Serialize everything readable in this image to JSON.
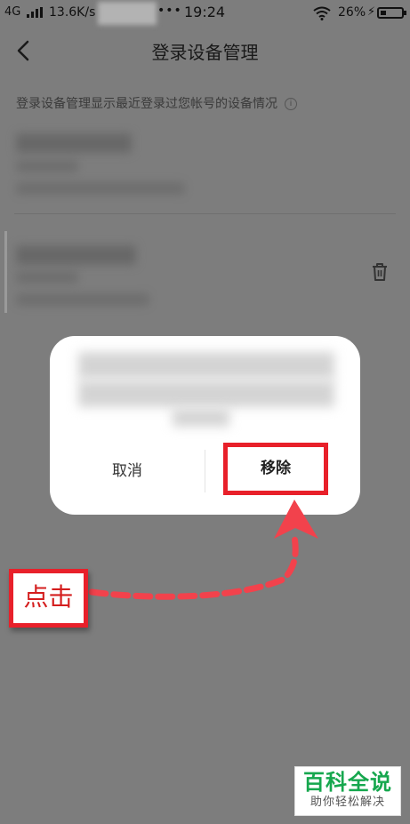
{
  "status_bar": {
    "network": "4G",
    "speed": "13.6K/s",
    "dots": "•••",
    "time": "19:24",
    "battery": "26%"
  },
  "header": {
    "title": "登录设备管理"
  },
  "description": "登录设备管理显示最近登录过您帐号的设备情况",
  "dialog": {
    "cancel_label": "取消",
    "remove_label": "移除"
  },
  "annotation": {
    "label": "点击"
  },
  "watermark": {
    "title": "百科全说",
    "subtitle": "助你轻松解决"
  },
  "colors": {
    "highlight": "#e8202a",
    "overlay": "#7d7d7d",
    "brand": "#16a74e"
  }
}
